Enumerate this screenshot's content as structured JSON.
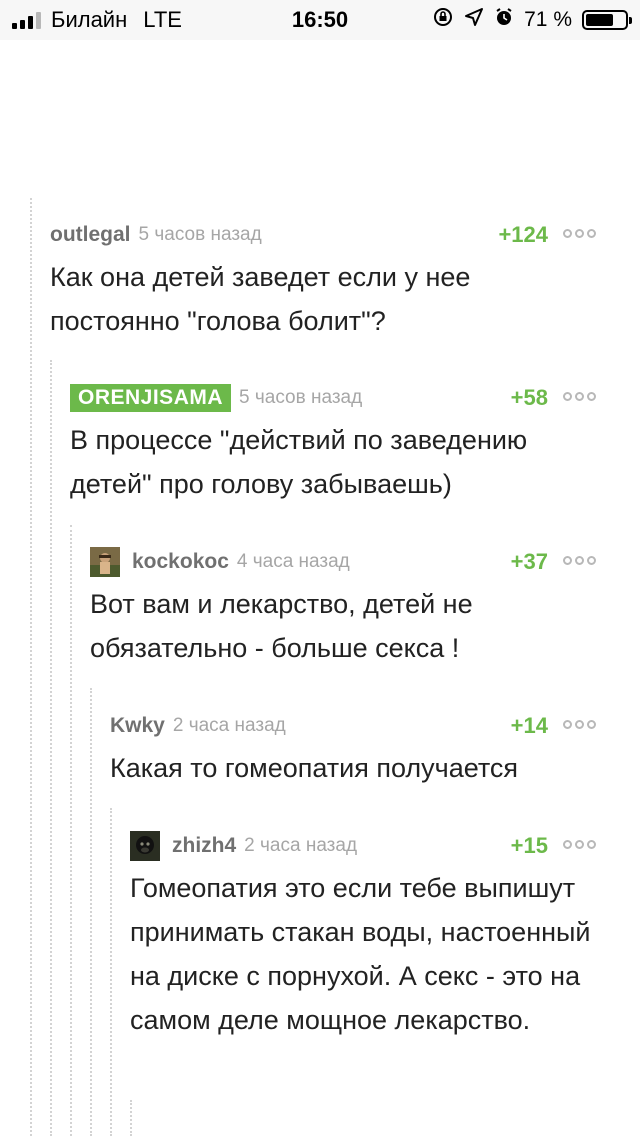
{
  "status_bar": {
    "carrier": "Билайн",
    "network": "LTE",
    "time": "16:50",
    "battery": "71 %",
    "battery_level": 0.71
  },
  "comments": [
    {
      "author": "outlegal",
      "time": "5 часов назад",
      "score": "+124",
      "text": "Как она детей заведет если у нее постоянно \"голова болит\"?"
    },
    {
      "author": "ORENJISAMA",
      "time": "5 часов назад",
      "score": "+58",
      "text": "В процессе \"действий по заведению детей\" про голову забываешь)"
    },
    {
      "author": "kockokoc",
      "time": "4 часа назад",
      "score": "+37",
      "text": "Вот вам и лекарство, детей не обязательно - больше секса !"
    },
    {
      "author": "Kwky",
      "time": "2 часа назад",
      "score": "+14",
      "text": "Какая то гомеопатия получается"
    },
    {
      "author": "zhizh4",
      "time": "2 часа назад",
      "score": "+15",
      "text": "Гомеопатия это если тебе выпишут принимать стакан воды, настоенный на диске с порнухой. А секс - это на самом деле мощное лекарство."
    }
  ],
  "colors": {
    "accent_green": "#6cb94a",
    "author_gray": "#707070",
    "time_gray": "#a6a6a6",
    "thread_line": "#d3d3d3"
  }
}
